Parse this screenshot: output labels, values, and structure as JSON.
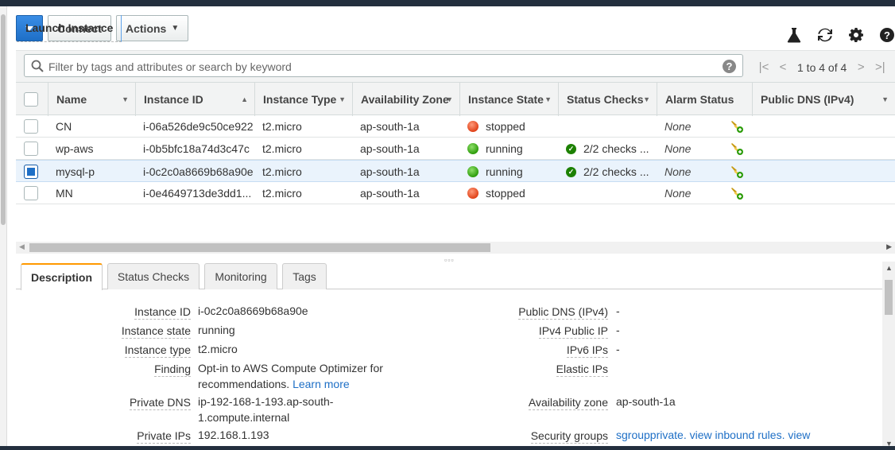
{
  "toolbar": {
    "launch_label": "Launch Instance",
    "connect_label": "Connect",
    "actions_label": "Actions"
  },
  "top_icons": [
    "flask-icon",
    "refresh-icon",
    "gear-icon",
    "help-icon"
  ],
  "search": {
    "placeholder": "Filter by tags and attributes or search by keyword",
    "help": "?"
  },
  "pager": {
    "text": "1 to 4 of 4",
    "first": "|<",
    "prev": "<",
    "next": ">",
    "last": ">|"
  },
  "columns": [
    "Name",
    "Instance ID",
    "Instance Type",
    "Availability Zone",
    "Instance State",
    "Status Checks",
    "Alarm Status",
    "Public DNS (IPv4)"
  ],
  "rows": [
    {
      "name": "CN",
      "id": "i-06a526de9c50ce922",
      "type": "t2.micro",
      "az": "ap-south-1a",
      "state": "stopped",
      "checks": "",
      "alarm": "None",
      "selected": false
    },
    {
      "name": "wp-aws",
      "id": "i-0b5bfc18a74d3c47c",
      "type": "t2.micro",
      "az": "ap-south-1a",
      "state": "running",
      "checks": "2/2 checks ...",
      "alarm": "None",
      "selected": false
    },
    {
      "name": "mysql-p",
      "id": "i-0c2c0a8669b68a90e",
      "type": "t2.micro",
      "az": "ap-south-1a",
      "state": "running",
      "checks": "2/2 checks ...",
      "alarm": "None",
      "selected": true
    },
    {
      "name": "MN",
      "id": "i-0e4649713de3dd1...",
      "type": "t2.micro",
      "az": "ap-south-1a",
      "state": "stopped",
      "checks": "",
      "alarm": "None",
      "selected": false
    }
  ],
  "colors": {
    "accent": "#1e6fc6",
    "running": "#2e9d0c",
    "stopped": "#e0431a",
    "tab_active": "#ff9900"
  },
  "tabs": [
    "Description",
    "Status Checks",
    "Monitoring",
    "Tags"
  ],
  "description": {
    "left": [
      {
        "label": "Instance ID",
        "value": "i-0c2c0a8669b68a90e"
      },
      {
        "label": "Instance state",
        "value": "running"
      },
      {
        "label": "Instance type",
        "value": "t2.micro"
      },
      {
        "label": "Finding",
        "value": "Opt-in to AWS Compute Optimizer for",
        "value2": "recommendations.",
        "link": "Learn more"
      },
      {
        "label": "Private DNS",
        "value": "ip-192-168-1-193.ap-south-",
        "value2": "1.compute.internal"
      },
      {
        "label": "Private IPs",
        "value": "192.168.1.193"
      }
    ],
    "right": [
      {
        "label": "Public DNS (IPv4)",
        "value": "-"
      },
      {
        "label": "IPv4 Public IP",
        "value": "-"
      },
      {
        "label": "IPv6 IPs",
        "value": "-"
      },
      {
        "label": "Elastic IPs",
        "value": ""
      },
      {
        "label": "Availability zone",
        "value": "ap-south-1a"
      },
      {
        "label": "Security groups",
        "link": "sgroupprivate. view inbound rules. view"
      }
    ]
  }
}
